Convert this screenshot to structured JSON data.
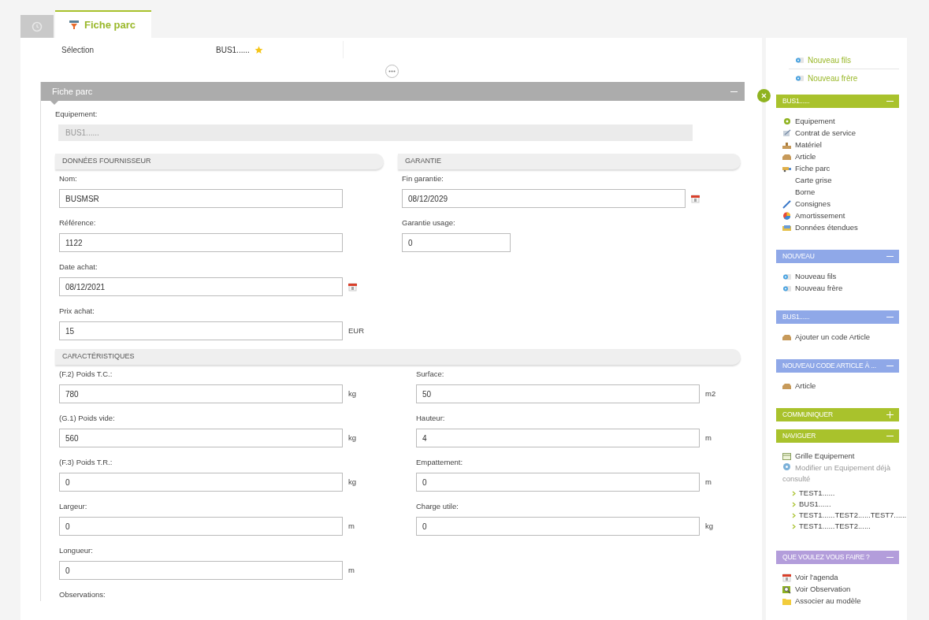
{
  "tabs": [
    {
      "kind": "history",
      "selected": false
    },
    {
      "kind": "page",
      "label": "Fiche parc",
      "selected": true
    }
  ],
  "selection": {
    "label": "Sélection",
    "value": "BUS1......",
    "starred": true
  },
  "panel": {
    "title": "Fiche parc",
    "expanded": true,
    "equipment_label": "Equipement:",
    "equipment_value": "BUS1......"
  },
  "groups": [
    {
      "title": "DONNÉES FOURNISSEUR",
      "columns": [
        [
          {
            "label": "Nom:",
            "value": "BUSMSR"
          },
          {
            "label": "Référence:",
            "value": "1122"
          },
          {
            "label": "Date achat:",
            "value": "08/12/2021",
            "calendar": true
          },
          {
            "label": "Prix achat:",
            "value": "15",
            "unit": "EUR"
          }
        ]
      ]
    },
    {
      "title": "GARANTIE",
      "columns": [
        [
          {
            "label": "Fin garantie:",
            "value": "08/12/2029",
            "calendar": true
          },
          {
            "label": "Garantie usage:",
            "value": "0",
            "short": true
          }
        ]
      ]
    },
    {
      "title": "CARACTÉRISTIQUES",
      "columns": [
        [
          {
            "label": "(F.2) Poids T.C.:",
            "value": "780",
            "unit": "kg"
          },
          {
            "label": "(G.1) Poids vide:",
            "value": "560",
            "unit": "kg"
          },
          {
            "label": "(F.3) Poids T.R.:",
            "value": "0",
            "unit": "kg"
          },
          {
            "label": "Largeur:",
            "value": "0",
            "unit": "m"
          },
          {
            "label": "Longueur:",
            "value": "0",
            "unit": "m"
          }
        ],
        [
          {
            "label": "Surface:",
            "value": "50",
            "unit": "m2"
          },
          {
            "label": "Hauteur:",
            "value": "4",
            "unit": "m"
          },
          {
            "label": "Empattement:",
            "value": "0",
            "unit": "m"
          },
          {
            "label": "Charge utile:",
            "value": "0",
            "unit": "kg"
          }
        ]
      ]
    }
  ],
  "observations_label": "Observations:",
  "sidebar": {
    "top_links": [
      {
        "label": "Nouveau fils",
        "kind": "node"
      },
      {
        "label": "Nouveau frère",
        "kind": "node"
      }
    ],
    "blocks": [
      {
        "title": "BUS1......",
        "color": "#a9c22c",
        "expanded": true,
        "items": [
          {
            "label": "Equipement",
            "kind": "gear"
          },
          {
            "label": "Contrat de service",
            "kind": "contract"
          },
          {
            "label": "Matériel",
            "kind": "material"
          },
          {
            "label": "Article",
            "kind": "article"
          },
          {
            "label": "Fiche parc",
            "kind": "fiche"
          },
          {
            "label": "Carte grise",
            "kind": "text"
          },
          {
            "label": "Borne",
            "kind": "text"
          },
          {
            "label": "Consignes",
            "kind": "pen"
          },
          {
            "label": "Amortissement",
            "kind": "pie"
          },
          {
            "label": "Données étendues",
            "kind": "data"
          }
        ]
      },
      {
        "title": "NOUVEAU",
        "color": "#8fa8e8",
        "expanded": true,
        "items": [
          {
            "label": "Nouveau fils",
            "kind": "node"
          },
          {
            "label": "Nouveau frère",
            "kind": "node"
          }
        ]
      },
      {
        "title": "BUS1......",
        "color": "#8fa8e8",
        "expanded": true,
        "items": [
          {
            "label": "Ajouter un code Article",
            "kind": "article"
          }
        ]
      },
      {
        "title": "NOUVEAU CODE ARTICLE À ...",
        "color": "#8fa8e8",
        "expanded": true,
        "items": [
          {
            "label": "Article",
            "kind": "article"
          }
        ]
      },
      {
        "title": "COMMUNIQUER",
        "color": "#a9c22c",
        "expanded": false
      },
      {
        "title": "NAVIGUER",
        "color": "#a9c22c",
        "expanded": true,
        "items": [
          {
            "label": "Grille Equipement",
            "kind": "grid"
          },
          {
            "label": "Modifier un Equipement déjà consulté",
            "kind": "disc",
            "disabled": true,
            "children": [
              {
                "label": "TEST1......"
              },
              {
                "label": "BUS1......"
              },
              {
                "label": "TEST1......TEST2......TEST7......"
              },
              {
                "label": "TEST1......TEST2......"
              }
            ]
          }
        ]
      },
      {
        "title": "QUE VOULEZ VOUS FAIRE ?",
        "color": "#b39ddb",
        "expanded": true,
        "items": [
          {
            "label": "Voir l'agenda",
            "kind": "calendar"
          },
          {
            "label": " Voir Observation",
            "kind": "observation"
          },
          {
            "label": "Associer au modèle",
            "kind": "folder"
          }
        ]
      }
    ]
  }
}
